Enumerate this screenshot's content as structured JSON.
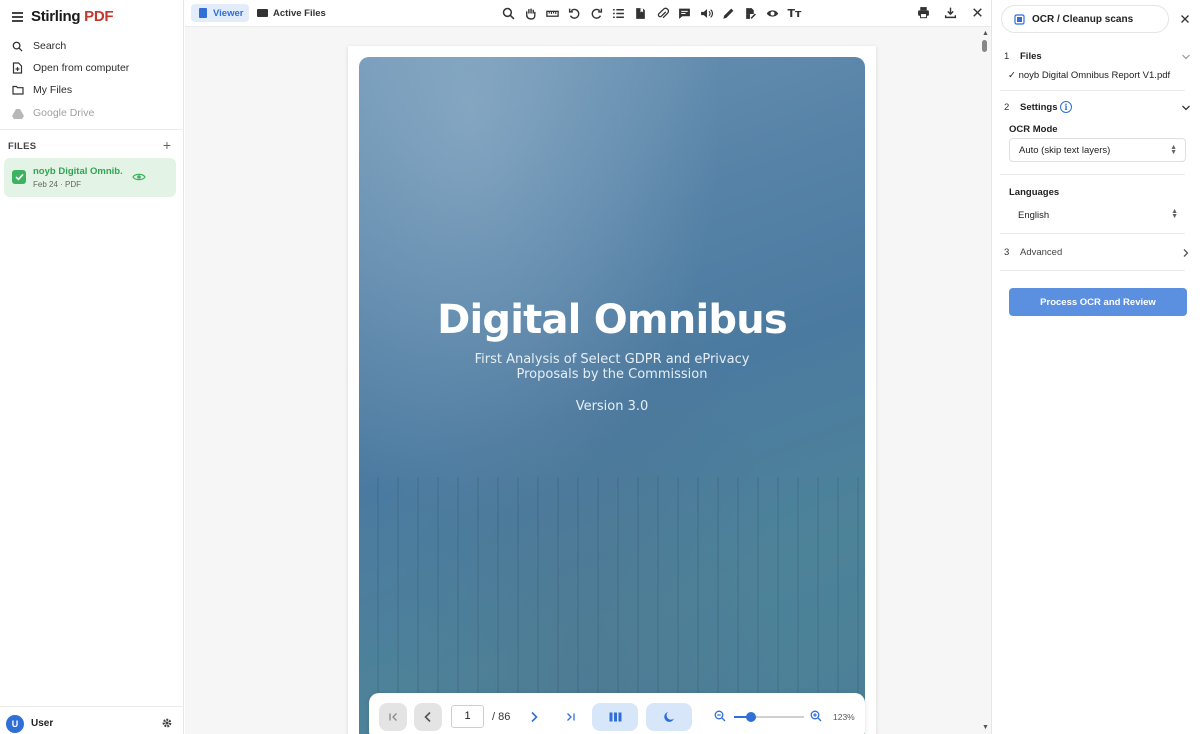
{
  "app": {
    "brand_primary": "Stirling",
    "brand_secondary": "PDF",
    "brand_accent_color": "#c0392b",
    "accent_color": "#2f6fd6"
  },
  "sidebar": {
    "nav": [
      {
        "label": "Search",
        "icon": "search-icon"
      },
      {
        "label": "Open from computer",
        "icon": "file-upload-icon"
      },
      {
        "label": "My Files",
        "icon": "folder-icon"
      },
      {
        "label": "Google Drive",
        "icon": "google-drive-icon",
        "disabled": true
      }
    ],
    "files_heading": "FILES",
    "add_label": "+",
    "file": {
      "name": "noyb Digital Omnib...",
      "meta": "Feb 24 · PDF",
      "selected": true
    },
    "user": {
      "initial": "U",
      "name": "User"
    }
  },
  "topbar": {
    "tabs": [
      {
        "label": "Viewer",
        "active": true
      },
      {
        "label": "Active Files",
        "active": false
      }
    ],
    "tools": [
      "search-icon",
      "hand-icon",
      "ruler-icon",
      "rotate-left-icon",
      "rotate-right-icon",
      "list-icon",
      "bookmark-icon",
      "attachment-icon",
      "comment-icon",
      "audio-icon",
      "pen-icon",
      "signature-icon",
      "eye-icon",
      "text-icon"
    ],
    "text_tool_label": "Tт",
    "right_tools": [
      "print-icon",
      "download-icon",
      "close-icon"
    ]
  },
  "document": {
    "title": "Digital Omnibus",
    "subtitle_line1": "First Analysis of Select GDPR and ePrivacy",
    "subtitle_line2": "Proposals by the Commission",
    "version": "Version 3.0"
  },
  "pager": {
    "current_page": "1",
    "total_pages": "/ 86",
    "zoom_percent": "123%",
    "zoom_fraction": 0.24
  },
  "panel": {
    "tool_name": "OCR / Cleanup scans",
    "steps": [
      {
        "num": "1",
        "title": "Files"
      },
      {
        "num": "2",
        "title": "Settings"
      },
      {
        "num": "3",
        "title": "Advanced"
      }
    ],
    "selected_file": "✓ noyb Digital Omnibus Report V1.pdf",
    "ocr_mode_label": "OCR Mode",
    "ocr_mode_value": "Auto (skip text layers)",
    "languages_label": "Languages",
    "languages_value": "English",
    "info_glyph": "i",
    "process_button": "Process OCR and Review"
  }
}
